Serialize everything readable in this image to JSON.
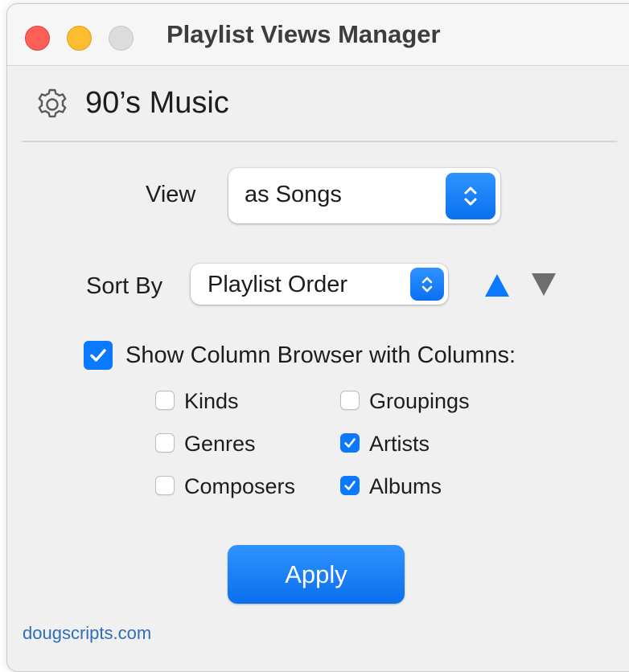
{
  "window": {
    "title": "Playlist Views Manager"
  },
  "header": {
    "playlist_name": "90’s Music",
    "icon": "gear-icon"
  },
  "view": {
    "label": "View",
    "selected": "as Songs"
  },
  "sort": {
    "label": "Sort By",
    "selected": "Playlist Order",
    "ascending_icon": "triangle-up-icon",
    "descending_icon": "triangle-down-icon"
  },
  "column_browser": {
    "label": "Show Column Browser with Columns:",
    "checked": true,
    "columns": [
      {
        "label": "Kinds",
        "checked": false
      },
      {
        "label": "Groupings",
        "checked": false
      },
      {
        "label": "Genres",
        "checked": false
      },
      {
        "label": "Artists",
        "checked": true
      },
      {
        "label": "Composers",
        "checked": false
      },
      {
        "label": "Albums",
        "checked": true
      }
    ]
  },
  "actions": {
    "apply_label": "Apply"
  },
  "footer": {
    "credit": "dougscripts.com"
  },
  "colors": {
    "accent": "#0a78ff",
    "close": "#fe5f57",
    "minimize": "#febc2e",
    "disabled": "#dcdcdc",
    "link": "#2e6dbb"
  }
}
